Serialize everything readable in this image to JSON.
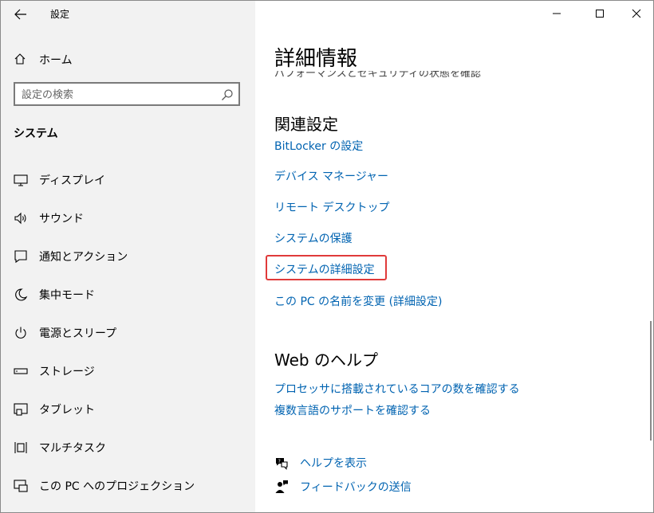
{
  "window": {
    "app_title": "設定"
  },
  "sidebar": {
    "home_label": "ホーム",
    "search": {
      "placeholder": "設定の検索"
    },
    "section_label": "システム",
    "items": [
      {
        "label": "ディスプレイ",
        "icon": "display-icon"
      },
      {
        "label": "サウンド",
        "icon": "sound-icon"
      },
      {
        "label": "通知とアクション",
        "icon": "notifications-icon"
      },
      {
        "label": "集中モード",
        "icon": "focus-moon-icon"
      },
      {
        "label": "電源とスリープ",
        "icon": "power-icon"
      },
      {
        "label": "ストレージ",
        "icon": "storage-icon"
      },
      {
        "label": "タブレット",
        "icon": "tablet-icon"
      },
      {
        "label": "マルチタスク",
        "icon": "multitask-icon"
      },
      {
        "label": "この PC へのプロジェクション",
        "icon": "projection-icon"
      }
    ]
  },
  "main": {
    "page_title": "詳細情報",
    "cut_text": "パフォーマンスとセキュリティの状態を確認",
    "related_heading": "関連設定",
    "related_links": [
      "BitLocker の設定",
      "デバイス マネージャー",
      "リモート デスクトップ",
      "システムの保護",
      "システムの詳細設定",
      "この PC の名前を変更 (詳細設定)"
    ],
    "web_help_heading": "Web のヘルプ",
    "web_help_links": [
      "プロセッサに搭載されているコアの数を確認する",
      "複数言語のサポートを確認する"
    ],
    "help_label": "ヘルプを表示",
    "feedback_label": "フィードバックの送信"
  },
  "colors": {
    "link": "#0063b1",
    "sidebar_bg": "#f2f2f2",
    "highlight": "#e03a3a"
  }
}
